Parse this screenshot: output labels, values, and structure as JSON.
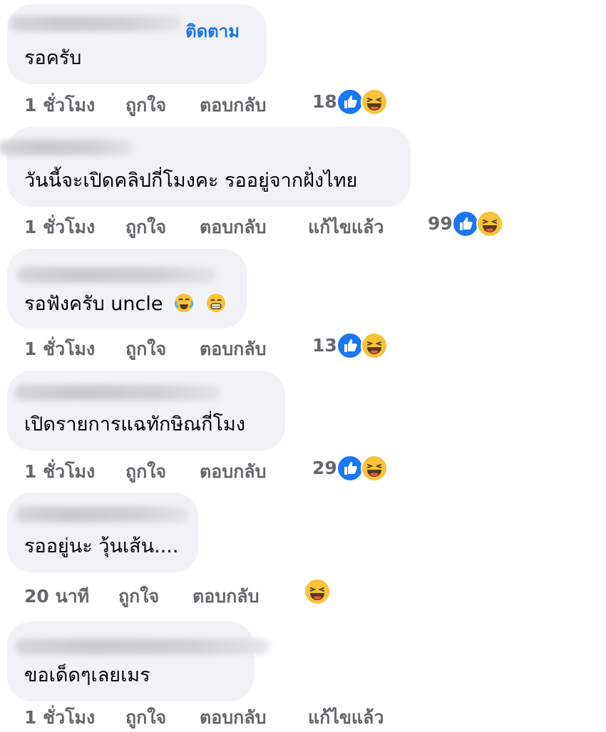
{
  "comments": [
    {
      "follow_label": "ติดตาม",
      "text": "รอครับ",
      "time": "1 ชั่วโมง",
      "like": "ถูกใจ",
      "reply": "ตอบกลับ",
      "edited": "",
      "count": "18"
    },
    {
      "follow_label": "",
      "text": "วันนี้จะเปิดคลิปกี่โมงคะ รออยู่จากฝั่งไทย",
      "time": "1 ชั่วโมง",
      "like": "ถูกใจ",
      "reply": "ตอบกลับ",
      "edited": "แก้ไขแล้ว",
      "count": "99"
    },
    {
      "follow_label": "",
      "text": "รอฟังครับ uncle",
      "time": "1 ชั่วโมง",
      "like": "ถูกใจ",
      "reply": "ตอบกลับ",
      "edited": "",
      "count": "13"
    },
    {
      "follow_label": "",
      "text": "เปิดรายการแฉทักษิณกี่โมง",
      "time": "1 ชั่วโมง",
      "like": "ถูกใจ",
      "reply": "ตอบกลับ",
      "edited": "",
      "count": "29"
    },
    {
      "follow_label": "",
      "text": "รออยู่นะ วุ้นเส้น....",
      "time": "20 นาที",
      "like": "ถูกใจ",
      "reply": "ตอบกลับ",
      "edited": "",
      "count": ""
    },
    {
      "follow_label": "",
      "text": "ขอเด็ดๆเลยเมร",
      "time": "1 ชั่วโมง",
      "like": "ถูกใจ",
      "reply": "ตอบกลับ",
      "edited": "แก้ไขแล้ว",
      "count": ""
    }
  ],
  "icons": {
    "like": "like-reaction-icon",
    "haha": "haha-reaction-icon",
    "inline": [
      "tears-of-joy-emoji",
      "grin-emoji"
    ]
  },
  "colors": {
    "like_blue": "#1877f2",
    "haha_yellow": "#f7c33b",
    "meta_gray": "#65676b",
    "bubble": "#f0f2f5",
    "follow_blue": "#1b74e4"
  }
}
